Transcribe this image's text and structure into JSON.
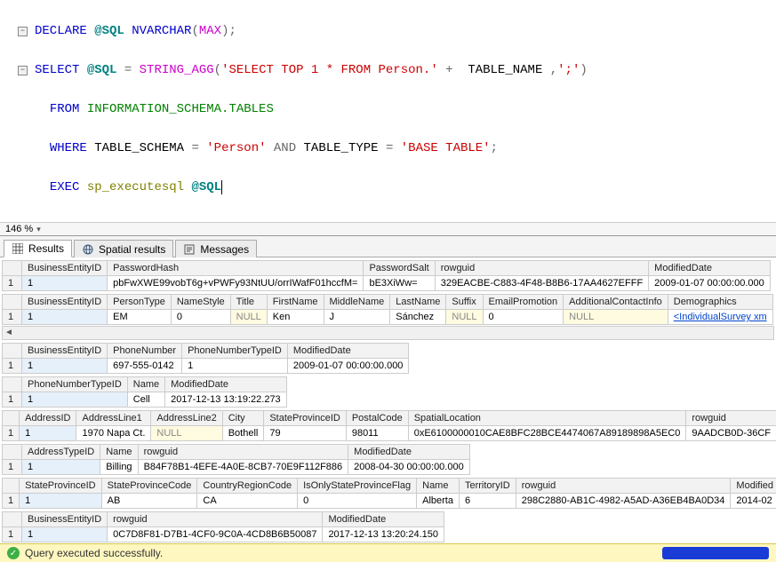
{
  "editor": {
    "l1": {
      "kw1": "DECLARE",
      "var": "@SQL",
      "kw2": "NVARCHAR",
      "paren1": "(",
      "max": "MAX",
      "paren2": ");"
    },
    "l2": {
      "kw1": "SELECT",
      "var": "@SQL",
      "eq": " = ",
      "fn": "STRING_AGG",
      "p1": "(",
      "str1": "'SELECT TOP 1 * FROM Person.'",
      "plus": " +  ",
      "col": "TABLE_NAME",
      "comma": " ,",
      "str2": "';'",
      "p2": ")"
    },
    "l3": {
      "kw": "FROM",
      "obj": "INFORMATION_SCHEMA.TABLES"
    },
    "l4": {
      "kw1": "WHERE",
      "col1": "TABLE_SCHEMA",
      "eq1": " = ",
      "str1": "'Person'",
      "and": "AND",
      "col2": "TABLE_TYPE",
      "eq2": " = ",
      "str2": "'BASE TABLE'",
      "semi": ";"
    },
    "l5": {
      "kw": "EXEC",
      "sp": "sp_executesql",
      "var": "@SQL"
    }
  },
  "zoom": "146 %",
  "tabs": {
    "results": "Results",
    "spatial": "Spatial results",
    "messages": "Messages"
  },
  "null_text": "NULL",
  "g1": {
    "h": [
      "BusinessEntityID",
      "PasswordHash",
      "PasswordSalt",
      "rowguid",
      "ModifiedDate"
    ],
    "r": [
      "1",
      "1",
      "pbFwXWE99vobT6g+vPWFy93NtUU/orrIWafF01hccfM=",
      "bE3XiWw=",
      "329EACBE-C883-4F48-B8B6-17AA4627EFFF",
      "2009-01-07 00:00:00.000"
    ]
  },
  "g2": {
    "h": [
      "BusinessEntityID",
      "PersonType",
      "NameStyle",
      "Title",
      "FirstName",
      "MiddleName",
      "LastName",
      "Suffix",
      "EmailPromotion",
      "AdditionalContactInfo",
      "Demographics"
    ],
    "r": [
      "1",
      "1",
      "EM",
      "0",
      "NULL",
      "Ken",
      "J",
      "Sánchez",
      "NULL",
      "0",
      "NULL",
      "<IndividualSurvey xm"
    ]
  },
  "g3": {
    "h": [
      "BusinessEntityID",
      "PhoneNumber",
      "PhoneNumberTypeID",
      "ModifiedDate"
    ],
    "r": [
      "1",
      "1",
      "697-555-0142",
      "1",
      "2009-01-07 00:00:00.000"
    ]
  },
  "g4": {
    "h": [
      "PhoneNumberTypeID",
      "Name",
      "ModifiedDate"
    ],
    "r": [
      "1",
      "1",
      "Cell",
      "2017-12-13 13:19:22.273"
    ]
  },
  "g5": {
    "h": [
      "AddressID",
      "AddressLine1",
      "AddressLine2",
      "City",
      "StateProvinceID",
      "PostalCode",
      "SpatialLocation",
      "rowguid"
    ],
    "r": [
      "1",
      "1",
      "1970 Napa Ct.",
      "NULL",
      "Bothell",
      "79",
      "98011",
      "0xE6100000010CAE8BFC28BCE4474067A89189898A5EC0",
      "9AADCB0D-36CF"
    ]
  },
  "g6": {
    "h": [
      "AddressTypeID",
      "Name",
      "rowguid",
      "ModifiedDate"
    ],
    "r": [
      "1",
      "1",
      "Billing",
      "B84F78B1-4EFE-4A0E-8CB7-70E9F112F886",
      "2008-04-30 00:00:00.000"
    ]
  },
  "g7": {
    "h": [
      "StateProvinceID",
      "StateProvinceCode",
      "CountryRegionCode",
      "IsOnlyStateProvinceFlag",
      "Name",
      "TerritoryID",
      "rowguid",
      "Modified"
    ],
    "r": [
      "1",
      "1",
      "AB",
      "CA",
      "0",
      "Alberta",
      "6",
      "298C2880-AB1C-4982-A5AD-A36EB4BA0D34",
      "2014-02"
    ]
  },
  "g8": {
    "h": [
      "BusinessEntityID",
      "rowguid",
      "ModifiedDate"
    ],
    "r": [
      "1",
      "1",
      "0C7D8F81-D7B1-4CF0-9C0A-4CD8B6B50087",
      "2017-12-13 13:20:24.150"
    ]
  },
  "status": "Query executed successfully."
}
